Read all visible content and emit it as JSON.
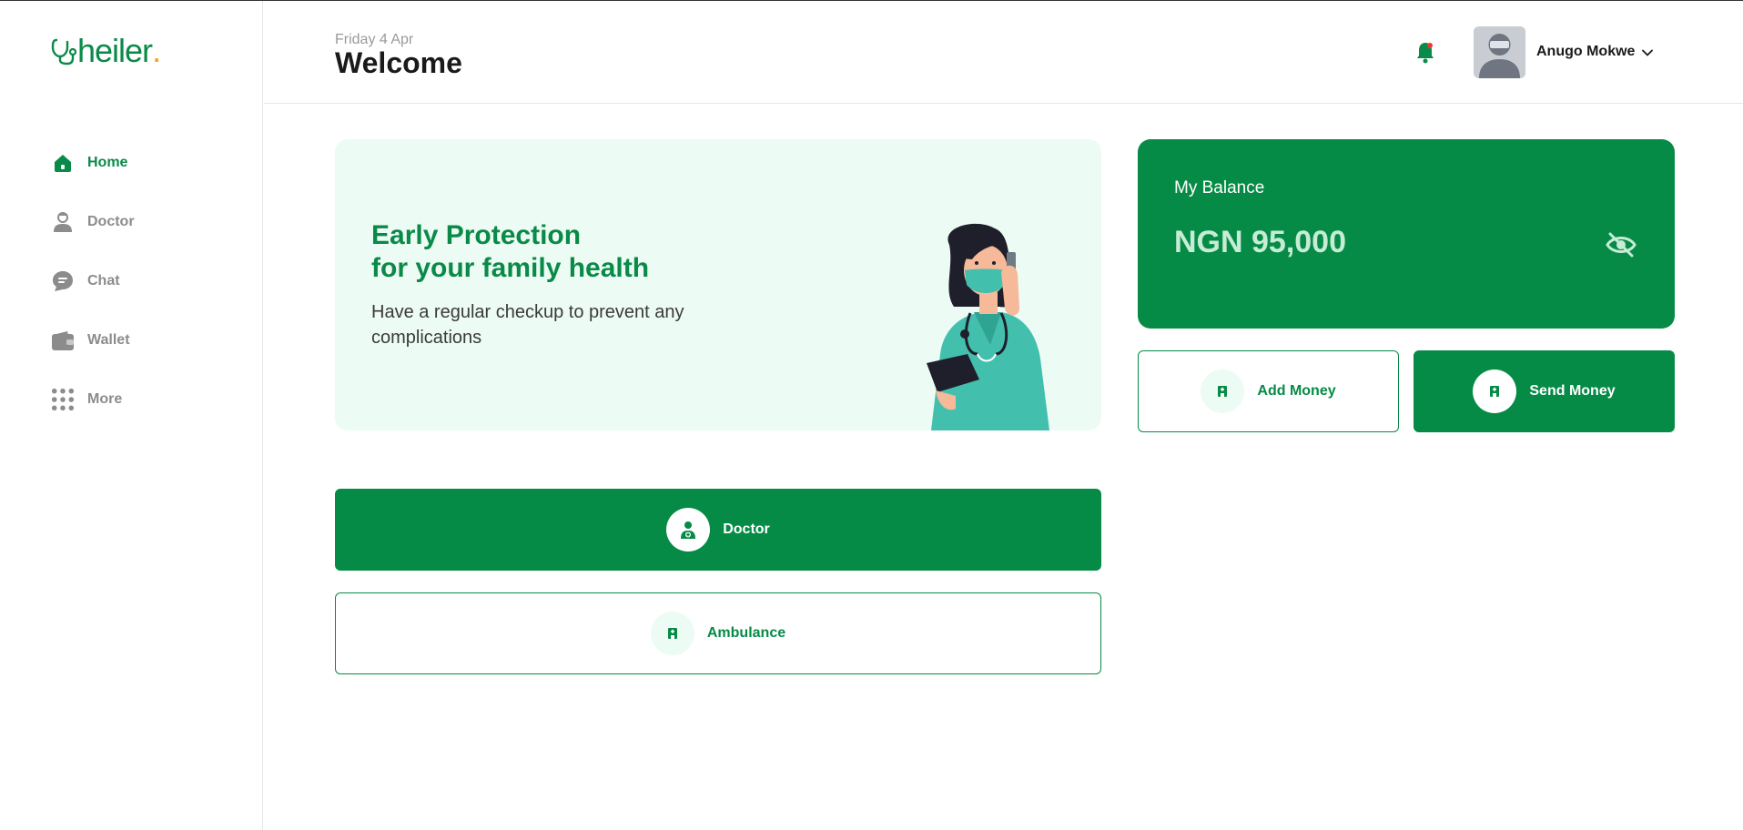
{
  "brand": {
    "name": "heiler",
    "dot": ".",
    "color": "#0a8a48",
    "dot_color": "#f5a21b"
  },
  "sidebar": {
    "items": [
      {
        "label": "Home",
        "icon": "home-icon",
        "active": true
      },
      {
        "label": "Doctor",
        "icon": "doctor-icon",
        "active": false
      },
      {
        "label": "Chat",
        "icon": "chat-icon",
        "active": false
      },
      {
        "label": "Wallet",
        "icon": "wallet-icon",
        "active": false
      },
      {
        "label": "More",
        "icon": "grid-icon",
        "active": false
      }
    ]
  },
  "header": {
    "date": "Friday 4 Apr",
    "title": "Welcome",
    "notification_icon": "bell-icon",
    "user": {
      "name": "Anugo Mokwe",
      "avatar_icon": "avatar",
      "menu_icon": "chevron-down-icon"
    }
  },
  "promo": {
    "title_line1": "Early Protection",
    "title_line2": "for your family health",
    "subtitle": "Have a regular checkup to prevent any complications",
    "illustration": "nurse-illustration"
  },
  "balance": {
    "label": "My Balance",
    "amount": "NGN 95,000",
    "visibility_icon": "eye-off-icon"
  },
  "wallet_actions": {
    "add": {
      "label": "Add Money",
      "icon": "hospital-icon"
    },
    "send": {
      "label": "Send Money",
      "icon": "hospital-icon"
    }
  },
  "services": {
    "doctor": {
      "label": "Doctor",
      "icon": "doctor-add-icon"
    },
    "ambulance": {
      "label": "Ambulance",
      "icon": "hospital-icon"
    }
  },
  "colors": {
    "primary": "#068b46",
    "light_bg": "#ecfcf4",
    "muted_text": "#8c8c8c"
  }
}
